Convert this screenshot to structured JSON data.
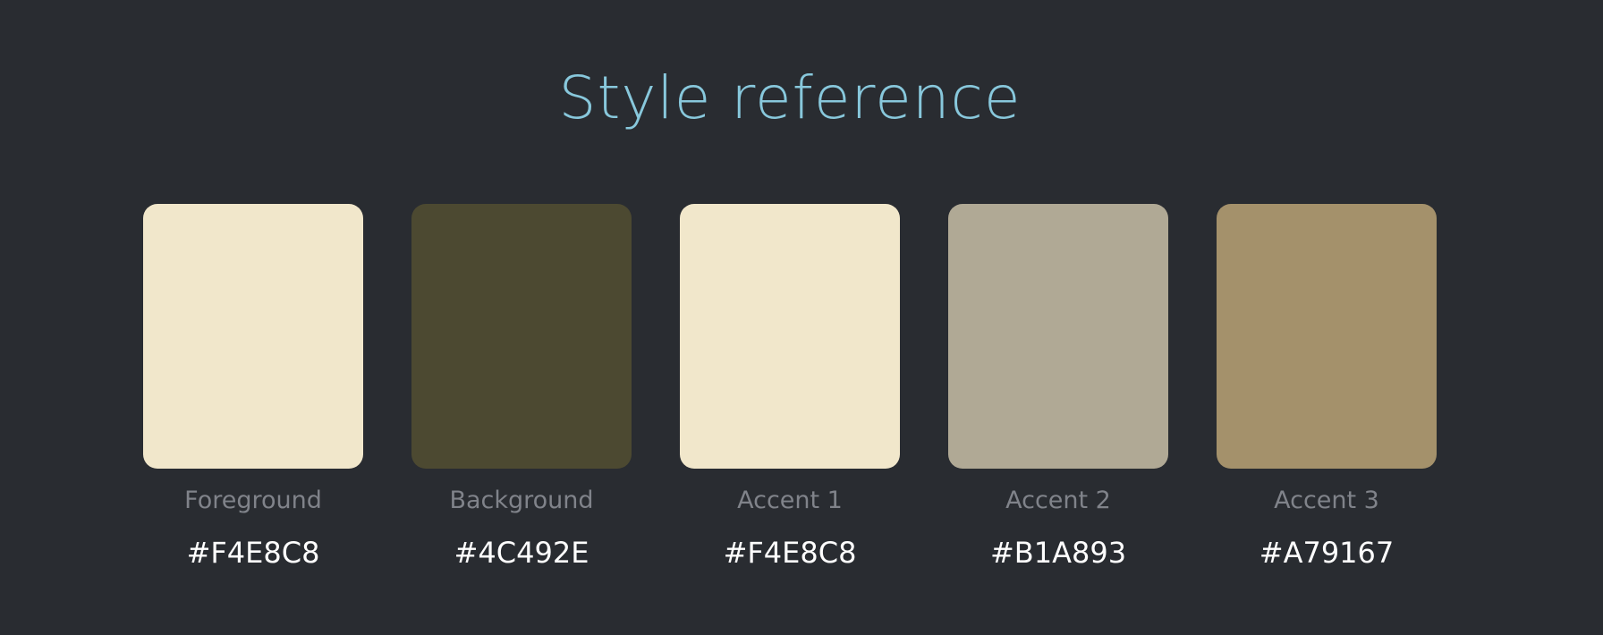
{
  "title": "Style reference",
  "accent_color": "#88c8dc",
  "background_color": "#292c31",
  "swatches": [
    {
      "label": "Foreground",
      "hex": "#F4E8C8",
      "display_color": "#F1E7CB"
    },
    {
      "label": "Background",
      "hex": "#4C492E",
      "display_color": "#4C4931"
    },
    {
      "label": "Accent 1",
      "hex": "#F4E8C8",
      "display_color": "#F1E7CB"
    },
    {
      "label": "Accent 2",
      "hex": "#B1A893",
      "display_color": "#B0A995"
    },
    {
      "label": "Accent 3",
      "hex": "#A79167",
      "display_color": "#A4916B"
    }
  ]
}
